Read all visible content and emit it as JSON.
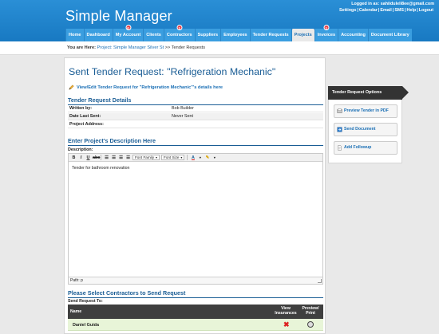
{
  "app": {
    "title": "Simple Manager",
    "login_text": "Logged in as: sahiiduleli8ee@gmail.com",
    "top_links": [
      "Settings",
      "Calendar",
      "Email",
      "SMS",
      "Help",
      "Logout"
    ]
  },
  "nav": {
    "items": [
      {
        "label": "Home",
        "badge": ""
      },
      {
        "label": "Dashboard",
        "badge": ""
      },
      {
        "label": "My Account",
        "badge": "0"
      },
      {
        "label": "Clients",
        "badge": ""
      },
      {
        "label": "Contractors",
        "badge": "1"
      },
      {
        "label": "Suppliers",
        "badge": ""
      },
      {
        "label": "Employees",
        "badge": ""
      },
      {
        "label": "Tender Requests",
        "badge": ""
      },
      {
        "label": "Projects",
        "badge": "",
        "active": true
      },
      {
        "label": "Invoices",
        "badge": "1"
      },
      {
        "label": "Accounting",
        "badge": ""
      },
      {
        "label": "Document Library",
        "badge": ""
      }
    ]
  },
  "breadcrumb": {
    "label": "You are Here:",
    "link": "Project: Simple Manager Silver St",
    "sep": ">>",
    "current": "Tender Requests"
  },
  "main": {
    "title": "Sent Tender Request: \"Refrigeration Mechanic\"",
    "edit_link": "View/Edit Tender Request for \"Refrigeration Mechanic\"'s details here",
    "details_title": "Tender Request Details",
    "details": [
      {
        "key": "Written by:",
        "value": "Bob Builder"
      },
      {
        "key": "Date Last Sent:",
        "value": "Never Sent"
      },
      {
        "key": "Project Address:",
        "value": ""
      }
    ],
    "description_title": "Enter Project's Description Here",
    "description_label": "Description:",
    "editor": {
      "font_family": "Font Family",
      "font_size": "Font Size",
      "content": "Tender for bathroom renovation",
      "path": "Path: p"
    },
    "contractors_title": "Please Select Contractors to Send Request",
    "send_label": "Send Request To:",
    "table": {
      "col_name": "Name",
      "col_insurances": "View Insurances",
      "col_preview": "Preview/ Print",
      "rows": [
        {
          "name": "Daniel Guida"
        }
      ]
    }
  },
  "side": {
    "title": "Tender Request Options",
    "buttons": [
      "Preview Tender in PDF",
      "Send Document",
      "Add Followup"
    ]
  }
}
